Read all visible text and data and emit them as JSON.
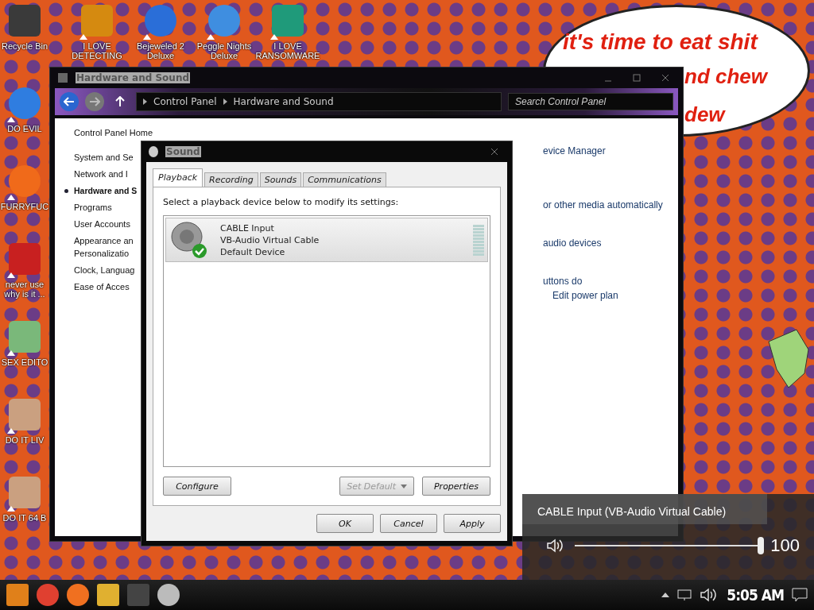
{
  "desktop": {
    "top_row": [
      {
        "label": "I LOVE DETECTING",
        "shortcut": true
      },
      {
        "label": "Bejeweled 2 Deluxe",
        "shortcut": true
      },
      {
        "label": "Peggle Nights Deluxe",
        "shortcut": true
      },
      {
        "label": "I LOVE RANSOMWARE",
        "shortcut": true
      }
    ],
    "left_column": [
      {
        "label": "Recycle Bin",
        "shortcut": false
      },
      {
        "label": "DO EVIL",
        "shortcut": true
      },
      {
        "label": "FURRYFUC",
        "shortcut": true
      },
      {
        "label": "never use why is it ...",
        "shortcut": true
      },
      {
        "label": "SEX EDITO",
        "shortcut": true
      },
      {
        "label": "DO IT LIV",
        "shortcut": true
      },
      {
        "label": "DO IT 64 B",
        "shortcut": true
      }
    ],
    "speech_bubble": {
      "lines": [
        "it's time to eat shit",
        "nd chew",
        "dew"
      ]
    }
  },
  "control_panel": {
    "title": "Hardware and Sound",
    "breadcrumb": [
      "Control Panel",
      "Hardware and Sound"
    ],
    "search": {
      "placeholder": "Search Control Panel"
    },
    "nav": [
      {
        "label": "Control Panel Home",
        "selected": false
      },
      {
        "label": "System and Se",
        "selected": false
      },
      {
        "label": "Network and I",
        "selected": false
      },
      {
        "label": "Hardware and S",
        "selected": true
      },
      {
        "label": "Programs",
        "selected": false
      },
      {
        "label": "User Accounts",
        "selected": false
      },
      {
        "label": "Appearance an Personalizatio",
        "selected": false
      },
      {
        "label": "Clock, Languag",
        "selected": false
      },
      {
        "label": "Ease of Acces",
        "selected": false
      }
    ],
    "fragments": [
      "evice Manager",
      "or other media automatically",
      "audio devices",
      "uttons do",
      "Edit power plan"
    ]
  },
  "sound_dialog": {
    "title": "Sound",
    "tabs": [
      {
        "label": "Playback",
        "selected": true
      },
      {
        "label": "Recording",
        "selected": false
      },
      {
        "label": "Sounds",
        "selected": false
      },
      {
        "label": "Communications",
        "selected": false
      }
    ],
    "instruction": "Select a playback device below to modify its settings:",
    "devices": [
      {
        "name": "CABLE Input",
        "description": "VB-Audio Virtual Cable",
        "status": "Default Device",
        "selected": true,
        "default": true
      }
    ],
    "buttons": [
      {
        "label": "Configure",
        "disabled": false
      },
      {
        "label": "Set Default",
        "disabled": true
      },
      {
        "label": "Properties",
        "disabled": false
      }
    ],
    "footer_buttons": [
      {
        "label": "OK"
      },
      {
        "label": "Cancel"
      },
      {
        "label": "Apply"
      }
    ]
  },
  "volume_flyout": {
    "device": "CABLE Input (VB-Audio Virtual Cable)",
    "level": 1.0,
    "reading": "100"
  },
  "taskbar": {
    "clock": "5:05 AM"
  }
}
